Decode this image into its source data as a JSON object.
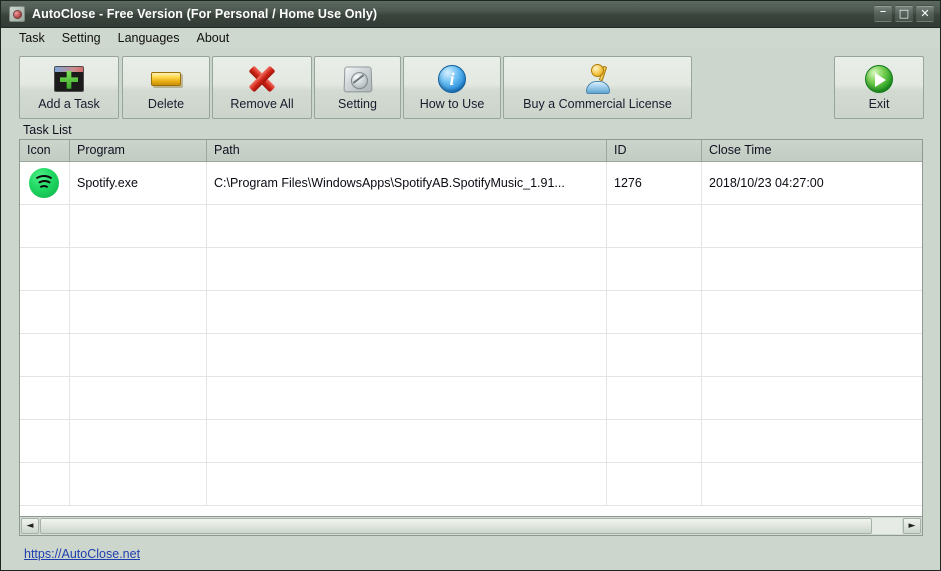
{
  "window": {
    "title": "AutoClose - Free Version (For Personal / Home Use Only)",
    "app_icon": "autoclose-app-icon",
    "controls": {
      "minimize": "–",
      "maximize": "□",
      "close": "✕"
    }
  },
  "menubar": {
    "items": [
      {
        "label": "Task"
      },
      {
        "label": "Setting"
      },
      {
        "label": "Languages"
      },
      {
        "label": "About"
      }
    ]
  },
  "toolbar": {
    "buttons": [
      {
        "label": "Add a Task",
        "icon": "add-task-icon"
      },
      {
        "label": "Delete",
        "icon": "delete-icon"
      },
      {
        "label": "Remove All",
        "icon": "remove-all-icon"
      },
      {
        "label": "Setting",
        "icon": "setting-icon"
      },
      {
        "label": "How to Use",
        "icon": "info-icon"
      },
      {
        "label": "Buy a Commercial License",
        "icon": "license-key-icon"
      }
    ],
    "exit": {
      "label": "Exit",
      "icon": "exit-icon"
    }
  },
  "tasklist": {
    "group_label": "Task List",
    "columns": [
      {
        "key": "icon",
        "label": "Icon"
      },
      {
        "key": "program",
        "label": "Program"
      },
      {
        "key": "path",
        "label": "Path"
      },
      {
        "key": "id",
        "label": "ID"
      },
      {
        "key": "close_time",
        "label": "Close Time"
      }
    ],
    "rows": [
      {
        "icon": "spotify-icon",
        "program": "Spotify.exe",
        "path": "C:\\Program Files\\WindowsApps\\SpotifyAB.SpotifyMusic_1.91...",
        "id": "1276",
        "close_time": "2018/10/23 04:27:00"
      }
    ],
    "empty_row_count": 7
  },
  "scrollbar": {
    "left_arrow": "◄",
    "right_arrow": "►"
  },
  "footer": {
    "link_text": "https://AutoClose.net"
  },
  "colors": {
    "titlebar": "#3a443d",
    "client_bg": "#ccd6cc",
    "header_bg": "#c7d0c7",
    "link": "#1f3fb0",
    "spotify_green": "#1ed760",
    "exit_green": "#22a024"
  }
}
